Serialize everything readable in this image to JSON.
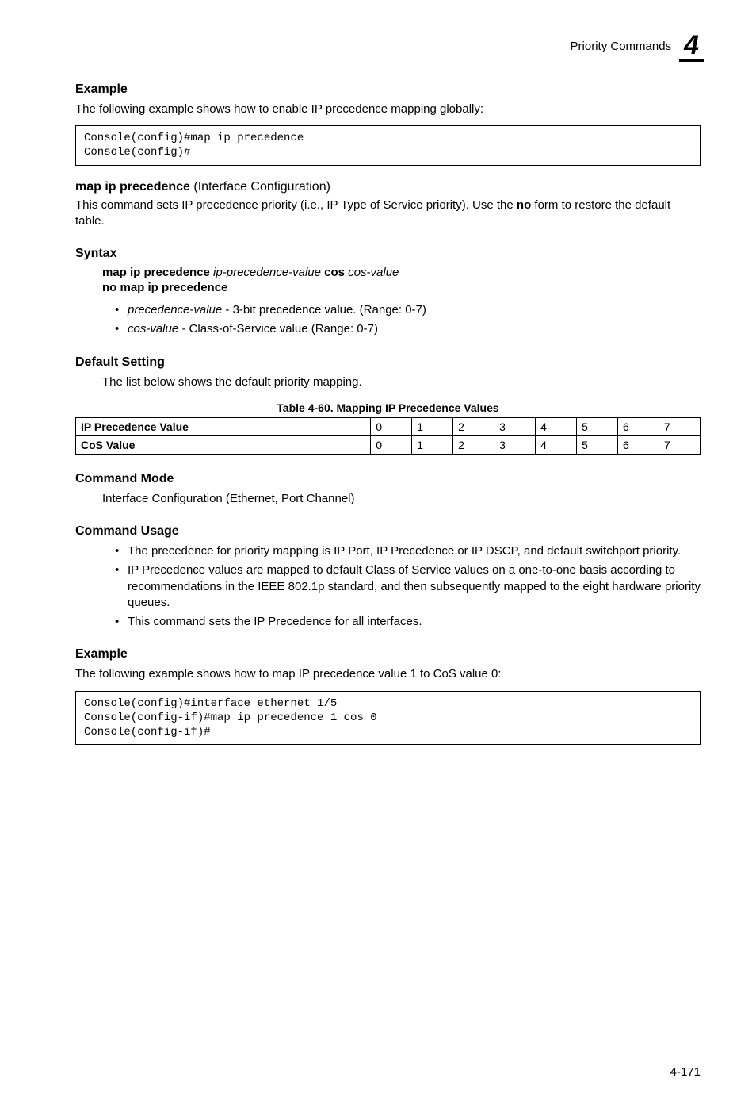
{
  "header": {
    "title": "Priority Commands",
    "chapter": "4"
  },
  "example1": {
    "heading": "Example",
    "intro": "The following example shows how to enable IP precedence mapping globally:",
    "code": "Console(config)#map ip precedence\nConsole(config)#"
  },
  "cmd": {
    "name": "map ip precedence",
    "context": " (Interface Configuration)",
    "desc_part1": "This command sets IP precedence priority (i.e., IP Type of Service priority). Use the ",
    "desc_bold": "no",
    "desc_part2": " form to restore the default table."
  },
  "syntax": {
    "heading": "Syntax",
    "line1_b1": "map ip precedence",
    "line1_i1": " ip-precedence-value ",
    "line1_b2": "cos",
    "line1_i2": " cos-value",
    "line2": "no map ip precedence",
    "bullets": [
      {
        "ital": "precedence-value",
        "rest": " - 3-bit precedence value. (Range: 0-7)"
      },
      {
        "ital": "cos-value -",
        "rest": " Class-of-Service value (Range: 0-7)"
      }
    ]
  },
  "default_setting": {
    "heading": "Default Setting",
    "text": "The list below shows the default priority mapping."
  },
  "table": {
    "caption": "Table 4-60.   Mapping IP Precedence Values",
    "row_labels": [
      "IP Precedence Value",
      "CoS Value"
    ]
  },
  "chart_data": {
    "type": "table",
    "title": "Mapping IP Precedence Values",
    "rows": [
      {
        "name": "IP Precedence Value",
        "values": [
          0,
          1,
          2,
          3,
          4,
          5,
          6,
          7
        ]
      },
      {
        "name": "CoS Value",
        "values": [
          0,
          1,
          2,
          3,
          4,
          5,
          6,
          7
        ]
      }
    ]
  },
  "command_mode": {
    "heading": "Command Mode",
    "text": "Interface Configuration (Ethernet, Port Channel)"
  },
  "command_usage": {
    "heading": "Command Usage",
    "bullets": [
      "The precedence for priority mapping is IP Port, IP Precedence or IP DSCP, and default switchport priority.",
      "IP Precedence values are mapped to default Class of Service values on a one-to-one basis according to recommendations in the IEEE 802.1p standard, and then subsequently mapped to the eight hardware priority queues.",
      "This command sets the IP Precedence for all interfaces."
    ]
  },
  "example2": {
    "heading": "Example",
    "intro": "The following example shows how to map IP precedence value 1 to CoS value 0:",
    "code": "Console(config)#interface ethernet 1/5\nConsole(config-if)#map ip precedence 1 cos 0\nConsole(config-if)#"
  },
  "footer": {
    "page": "4-171"
  }
}
